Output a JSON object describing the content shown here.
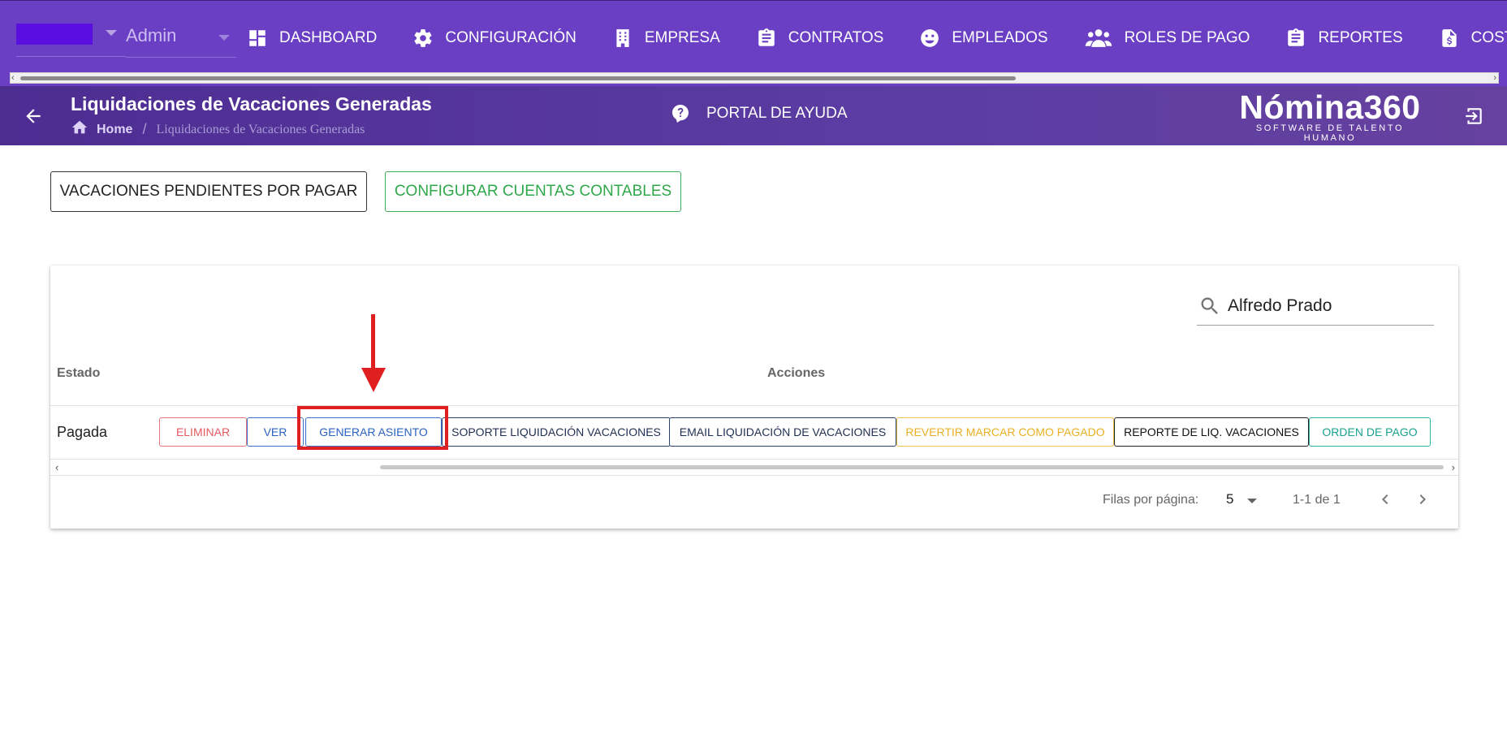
{
  "topnav": {
    "role_label": "Admin",
    "items": [
      {
        "label": "DASHBOARD",
        "icon": "dashboard-icon"
      },
      {
        "label": "CONFIGURACIÓN",
        "icon": "gear-icon"
      },
      {
        "label": "EMPRESA",
        "icon": "building-icon"
      },
      {
        "label": "CONTRATOS",
        "icon": "clipboard-icon"
      },
      {
        "label": "EMPLEADOS",
        "icon": "face-icon"
      },
      {
        "label": "ROLES DE PAGO",
        "icon": "group-icon"
      },
      {
        "label": "REPORTES",
        "icon": "clipboard-icon"
      },
      {
        "label": "COSTOS",
        "icon": "invoice-dollar-icon"
      }
    ],
    "colors": {
      "background": "#6a3fc4",
      "company_swatch": "#5b0ee0"
    }
  },
  "subheader": {
    "title": "Liquidaciones de Vacaciones Generadas",
    "breadcrumb": {
      "home": "Home",
      "separator": "/",
      "current": "Liquidaciones de Vacaciones Generadas"
    },
    "help_label": "PORTAL DE AYUDA",
    "brand": {
      "name": "Nómina360",
      "tagline": "SOFTWARE DE TALENTO HUMANO"
    }
  },
  "toolbar": {
    "pending_label": "VACACIONES PENDIENTES POR PAGAR",
    "config_label": "CONFIGURAR CUENTAS CONTABLES"
  },
  "table": {
    "search_value": "Alfredo Prado",
    "headers": {
      "estado": "Estado",
      "acciones": "Acciones"
    },
    "rows": [
      {
        "estado": "Pagada",
        "actions": {
          "eliminar": "ELIMINAR",
          "ver": "VER",
          "generar_asiento": "GENERAR ASIENTO",
          "soporte": "SOPORTE LIQUIDACIÓN VACACIONES",
          "email": "EMAIL LIQUIDACIÓN DE VACACIONES",
          "revertir": "REVERTIR MARCAR COMO PAGADO",
          "reporte": "REPORTE DE LIQ. VACACIONES",
          "orden_pago": "ORDEN DE PAGO"
        }
      }
    ],
    "footer": {
      "rows_per_page_label": "Filas por página:",
      "rows_per_page": "5",
      "range": "1-1 de 1"
    }
  },
  "annotation": {
    "highlight_color": "#e02020",
    "target": "generar_asiento"
  }
}
